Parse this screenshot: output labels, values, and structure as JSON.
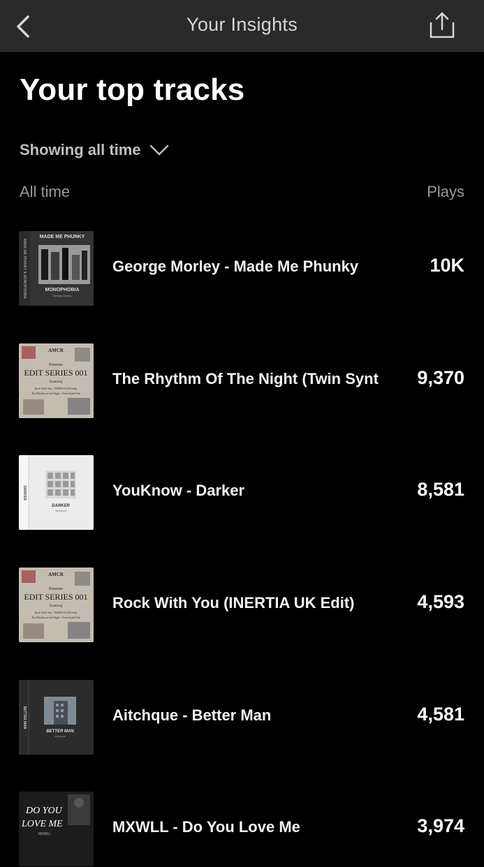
{
  "header": {
    "title": "Your Insights",
    "back_icon": "chevron-left-icon",
    "share_icon": "share-icon"
  },
  "page": {
    "heading": "Your top tracks",
    "filter_label": "Showing all time",
    "filter_icon": "chevron-down-icon"
  },
  "columns": {
    "left": "All time",
    "right": "Plays"
  },
  "tracks": [
    {
      "title": "George Morley - Made Me Phunky",
      "plays": "10K",
      "art": {
        "top_text": "MADE ME PHUNKY",
        "bottom_text": "MONOPHOBIA",
        "sub_text": "George Morley",
        "side_text": "MADE ME PHUNKY & MONOPHOBIA"
      }
    },
    {
      "title": "The Rhythm Of The Night (Twin Synt",
      "plays": "9,370",
      "art": {
        "logo": "AMCR",
        "line1": "Presents",
        "line2": "EDIT SERIES 001",
        "line3": "Featuring",
        "line4": "Rock With You - INERTIA (UK Edit)",
        "line5": "The Rhythm of the Night - Twin Synth Edit"
      }
    },
    {
      "title": "YouKnow - Darker",
      "plays": "8,581",
      "art": {
        "main_text": "DARKER",
        "sub_text": "YouKnow",
        "side_text": "DARKER"
      }
    },
    {
      "title": "Rock With You (INERTIA UK Edit)",
      "plays": "4,593",
      "art": {
        "logo": "AMCR",
        "line1": "Presents",
        "line2": "EDIT SERIES 001",
        "line3": "Featuring",
        "line4": "Rock With You - INERTIA (UK Edit)",
        "line5": "The Rhythm of the Night - Twin Synth Edit"
      }
    },
    {
      "title": "Aitchque - Better Man",
      "plays": "4,581",
      "art": {
        "main_text": "BETTER MAN",
        "sub_text": "Aitchque",
        "side_text": "BETTER MAN"
      }
    },
    {
      "title": "MXWLL - Do You Love Me",
      "plays": "3,974",
      "art": {
        "line1": "DO YOU",
        "line2": "LOVE ME",
        "sub_text": "MXWLL"
      }
    }
  ],
  "colors": {
    "background": "#000000",
    "nav_background": "#2a2a2a",
    "muted_text": "#9a9a9a"
  }
}
